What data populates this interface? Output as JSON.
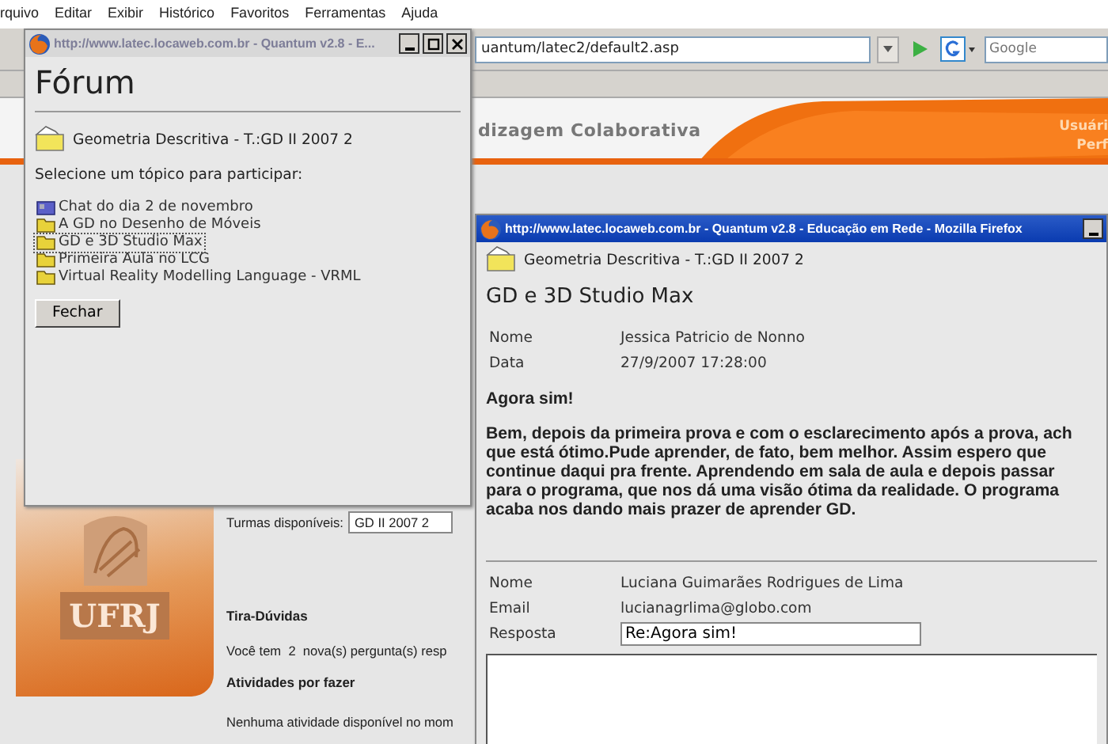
{
  "browser": {
    "menu": [
      "rquivo",
      "Editar",
      "Exibir",
      "Histórico",
      "Favoritos",
      "Ferramentas",
      "Ajuda"
    ],
    "address": "uantum/latec2/default2.asp",
    "search_placeholder": "Google",
    "banner": {
      "title": "dizagem Colaborativa",
      "user_lines": [
        "Usuári",
        "Perf"
      ]
    },
    "page": {
      "logo_text": "UFRJ",
      "classes_label": "Turmas disponíveis:",
      "classes_value": "GD II 2007 2",
      "sections": [
        {
          "heading": "Tira-Dúvidas",
          "text": "Você tem  2  nova(s) pergunta(s) resp"
        },
        {
          "heading": "Atividades por fazer",
          "text": "Nenhuma atividade disponível no mom"
        }
      ]
    }
  },
  "forum_window": {
    "title": "http://www.latec.locaweb.com.br - Quantum v2.8 - E...",
    "active": false,
    "heading": "Fórum",
    "course": "Geometria Descritiva - T.:GD II 2007 2",
    "prompt": "Selecione um tópico para participar:",
    "topics": [
      {
        "label": "Chat do dia 2 de novembro",
        "kind": "chat",
        "selected": false
      },
      {
        "label": "A GD no Desenho de Móveis",
        "kind": "folder",
        "selected": false
      },
      {
        "label": "GD e 3D Studio Max",
        "kind": "folder",
        "selected": true
      },
      {
        "label": "Primeira Aula no LCG",
        "kind": "folder",
        "selected": false
      },
      {
        "label": "Virtual Reality Modelling Language - VRML",
        "kind": "folder",
        "selected": false
      }
    ],
    "close_button": "Fechar"
  },
  "message_window": {
    "title": "http://www.latec.locaweb.com.br - Quantum v2.8 - Educação em Rede - Mozilla Firefox",
    "active": true,
    "course": "Geometria Descritiva - T.:GD II 2007 2",
    "topic": "GD e 3D Studio Max",
    "fields": [
      {
        "label": "Nome",
        "value": "Jessica Patricio de Nonno"
      },
      {
        "label": "Data",
        "value": "27/9/2007 17:28:00"
      }
    ],
    "subject": "Agora sim!",
    "body_lines": [
      "Bem, depois da primeira prova e com o esclarecimento após a prova, ach",
      "que está ótimo.Pude aprender, de fato, bem melhor. Assim espero que",
      "continue daqui pra frente. Aprendendo em sala de aula e depois passar",
      "para o programa, que nos dá uma visão ótima da realidade. O programa",
      "acaba nos dando mais prazer de aprender GD."
    ],
    "reply_fields": [
      {
        "label": "Nome",
        "value": "Luciana Guimarães Rodrigues de Lima"
      },
      {
        "label": "Email",
        "value": "lucianagrlima@globo.com"
      }
    ],
    "answer_label": "Resposta",
    "answer_value": "Re:Agora sim!"
  }
}
